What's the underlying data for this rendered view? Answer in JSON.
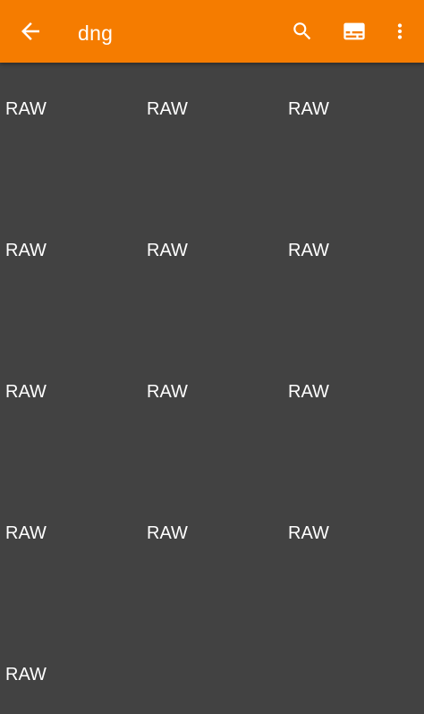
{
  "app_bar": {
    "title": "dng",
    "background_color": "#f57c00",
    "icons": {
      "back": "arrow-back-icon",
      "search": "search-icon",
      "view": "view-toggle-icon",
      "more": "more-vert-icon"
    }
  },
  "grid": {
    "background_color": "#424242",
    "items": [
      {
        "label": "RAW"
      },
      {
        "label": "RAW"
      },
      {
        "label": "RAW"
      },
      {
        "label": "RAW"
      },
      {
        "label": "RAW"
      },
      {
        "label": "RAW"
      },
      {
        "label": "RAW"
      },
      {
        "label": "RAW"
      },
      {
        "label": "RAW"
      },
      {
        "label": "RAW"
      },
      {
        "label": "RAW"
      },
      {
        "label": "RAW"
      },
      {
        "label": "RAW"
      }
    ]
  }
}
